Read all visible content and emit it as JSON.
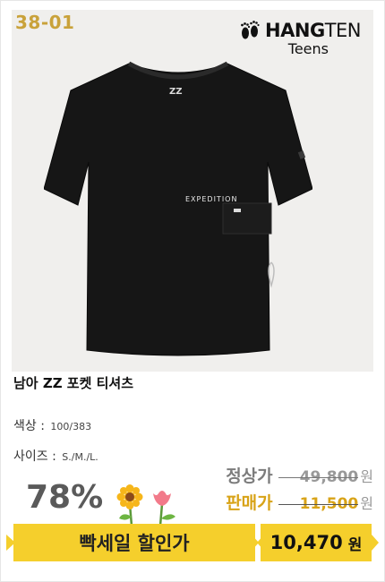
{
  "product": {
    "code": "38-01",
    "brand_name_bold": "HANG",
    "brand_name_thin": "TEN",
    "brand_sub": "Teens",
    "chest_print": "ZZ",
    "chest_logo": "EXPEDITION",
    "name": "남아 ZZ 포켓 티셔츠",
    "color_label": "색상 :",
    "color_value": "100/383",
    "size_label": "사이즈 :",
    "size_value": "S./M./L."
  },
  "pricing": {
    "discount_rate": "78%",
    "regular_label": "정상가",
    "regular_price": "49,800",
    "sale_label": "판매가",
    "sale_price": "11,500",
    "won": "원",
    "banner_text": "빡세일 할인가",
    "final_price": "10,470",
    "final_won": "원"
  },
  "colors": {
    "accent_yellow": "#f5cf2c",
    "code_gold": "#c9a23a",
    "sale_gold": "#d8a317",
    "image_bg": "#f0efed"
  },
  "icons": [
    "footprint-logo-icon",
    "sunflower-icon",
    "tulip-icon"
  ]
}
